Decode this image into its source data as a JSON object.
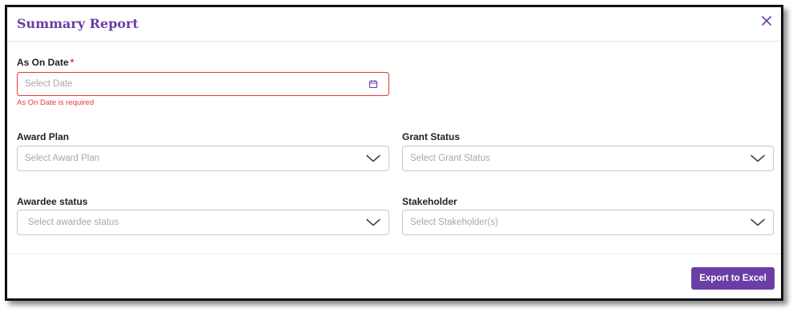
{
  "dialog": {
    "title": "Summary Report",
    "close_icon": "close-icon"
  },
  "fields": {
    "as_on_date": {
      "label": "As On Date",
      "required_mark": "*",
      "placeholder": "Select Date",
      "icon": "calendar-icon",
      "error": "As On Date is required"
    },
    "award_plan": {
      "label": "Award Plan",
      "placeholder": "Select Award Plan",
      "icon": "chevron-down-icon"
    },
    "grant_status": {
      "label": "Grant Status",
      "placeholder": "Select Grant Status",
      "icon": "chevron-down-icon"
    },
    "awardee_status": {
      "label": "Awardee status",
      "placeholder": "Select awardee status",
      "icon": "chevron-down-icon"
    },
    "stakeholder": {
      "label": "Stakeholder",
      "placeholder": "Select Stakeholder(s)",
      "icon": "chevron-down-icon"
    }
  },
  "footer": {
    "export_label": "Export to Excel"
  },
  "colors": {
    "accent": "#6a3ea5",
    "error": "#e53935"
  }
}
